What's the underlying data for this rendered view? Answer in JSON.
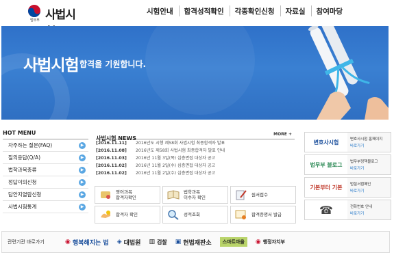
{
  "header": {
    "logo_text": "사법시험",
    "logo_sub": "법무부",
    "nav": [
      "시험안내",
      "합격성적확인",
      "각종확인신청",
      "자료실",
      "참여마당"
    ]
  },
  "banner": {
    "title": "사법시험",
    "subtitle": "합격을 기원합니다."
  },
  "hot_menu": {
    "title": "HOT MENU",
    "items": [
      "자주하는 질문(FAQ)",
      "질의응답(Q/A)",
      "법학과목종류",
      "정답이의신청",
      "답안지열람신청",
      "사법시험통계"
    ]
  },
  "news": {
    "title": "사법시험 NEWS",
    "more": "MORE +",
    "items": [
      {
        "date": "[2016.11.11]",
        "text": "2016년도 시행 제58회 사법시험 최종합격자 발표"
      },
      {
        "date": "[2016.11.08]",
        "text": "2016년도 제58회 사법시험 최종합격자 발표 안내"
      },
      {
        "date": "[2016.11.03]",
        "text": "2016년 11월 3일(목) 심층면접 대상자 공고"
      },
      {
        "date": "[2016.11.02]",
        "text": "2016년 11월 2일(수) 심층면접 대상자 공고"
      },
      {
        "date": "[2016.11.02]",
        "text": "2016년 11월 2일(수) 심층면접 대상자 공고"
      }
    ]
  },
  "quick": [
    {
      "label": "영어과목\n합격자확인",
      "icon": "scroll-icon"
    },
    {
      "label": "법학과목\n이수자 확인",
      "icon": "book-icon"
    },
    {
      "label": "원서접수",
      "icon": "pen-icon"
    },
    {
      "label": "합격자 확인",
      "icon": "hand-icon"
    },
    {
      "label": "성적조회",
      "icon": "magnifier-icon"
    },
    {
      "label": "합격증명서 발급",
      "icon": "certificate-icon"
    }
  ],
  "right_links": [
    {
      "logo": "변호사시험",
      "name": "변호사시험 홈페이지",
      "go": "바로가기"
    },
    {
      "logo": "법무부 블로그",
      "name": "법무부정책블로그",
      "go": "바로가기"
    },
    {
      "logo": "기본부터 기본",
      "name": "법질서캠페인",
      "go": "바로가기"
    },
    {
      "logo": "☎",
      "name": "전화번호 안내",
      "go": "바로가기"
    }
  ],
  "footer": {
    "title": "관련기관 바로가기",
    "links": [
      "행복해지는 법",
      "대법원",
      "검찰",
      "헌법재판소",
      "스마트마을",
      "행정자치부"
    ]
  },
  "colors": {
    "banner": "#3a80d2",
    "accent": "#5aa7e3",
    "link": "#1c73c7"
  }
}
